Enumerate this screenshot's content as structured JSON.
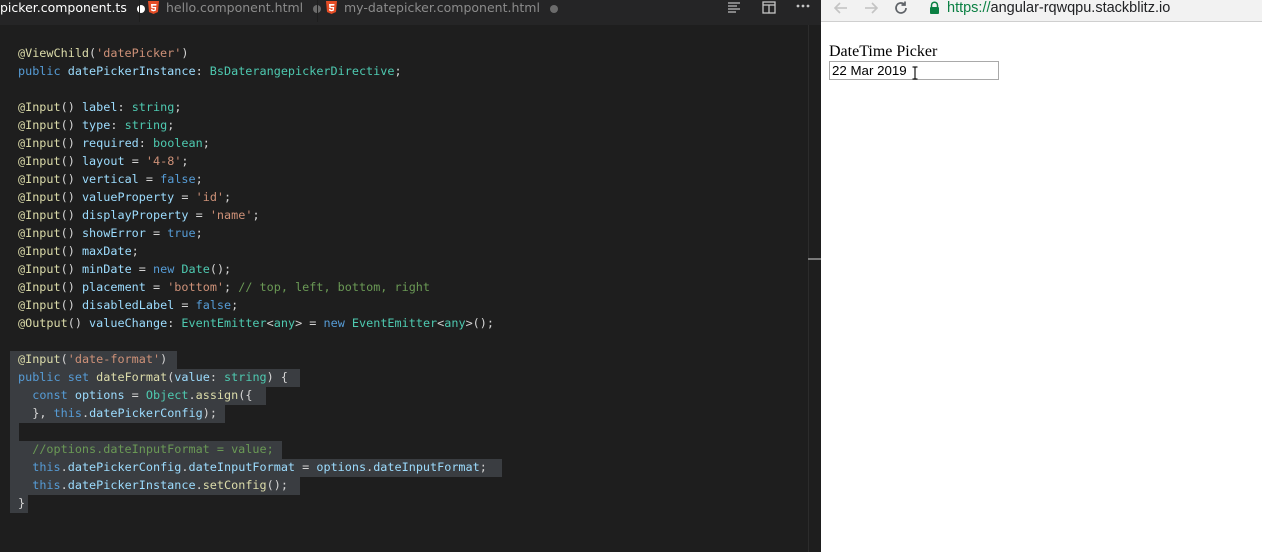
{
  "editor": {
    "tabs": [
      {
        "label": "picker.component.ts",
        "active": true
      },
      {
        "label": "hello.component.html",
        "active": false
      },
      {
        "label": "my-datepicker.component.html",
        "active": false
      }
    ],
    "toolbar_icons": [
      "split-editor-icon",
      "open-preview-icon",
      "more-actions-icon"
    ],
    "lines": [
      "@ViewChild('datePicker')",
      "public datePickerInstance: BsDaterangepickerDirective;",
      "",
      "@Input() label: string;",
      "@Input() type: string;",
      "@Input() required: boolean;",
      "@Input() layout = '4-8';",
      "@Input() vertical = false;",
      "@Input() valueProperty = 'id';",
      "@Input() displayProperty = 'name';",
      "@Input() showError = true;",
      "@Input() maxDate;",
      "@Input() minDate = new Date();",
      "@Input() placement = 'bottom'; // top, left, bottom, right",
      "@Input() disabledLabel = false;",
      "@Output() valueChange: EventEmitter<any> = new EventEmitter<any>();",
      "",
      "@Input('date-format')",
      "public set dateFormat(value: string) {",
      "  const options = Object.assign({",
      "  }, this.datePickerConfig);",
      "",
      "  //options.dateInputFormat = value;",
      "  this.datePickerConfig.dateInputFormat = options.dateInputFormat;",
      "  this.datePickerInstance.setConfig();",
      "}"
    ],
    "colors": {
      "background": "#1e1e1e",
      "keyword": "#569cd6",
      "type": "#4ec9b0",
      "string": "#ce9178",
      "comment": "#6a9955",
      "function": "#dcdcaa",
      "variable": "#9cdcfe",
      "selection": "#3a3d41"
    }
  },
  "browser": {
    "url_scheme": "https://",
    "url_host": "angular-rqwqpu.stackblitz.io",
    "page_title": "DateTime Picker",
    "date_value": "22 Mar 2019",
    "nav_icons": [
      "back-arrow-icon",
      "forward-arrow-icon",
      "reload-icon",
      "lock-icon"
    ]
  }
}
